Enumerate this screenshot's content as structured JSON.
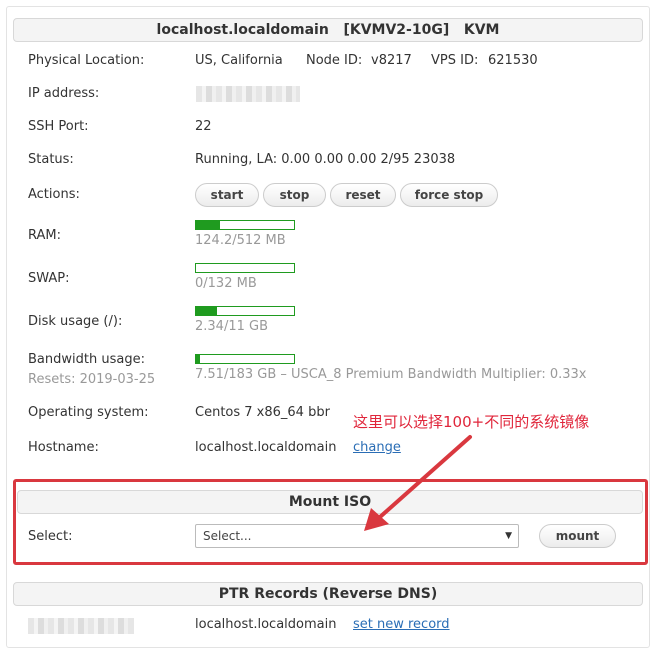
{
  "header": {
    "title": "localhost.localdomain   [KVMV2-10G]   KVM"
  },
  "info": {
    "physical_location_label": "Physical Location:",
    "physical_location_value": "US, California",
    "node_id_label": "Node ID:",
    "node_id_value": "v8217",
    "vps_id_label": "VPS ID:",
    "vps_id_value": "621530",
    "ip_label": "IP address:",
    "ssh_port_label": "SSH Port:",
    "ssh_port_value": "22",
    "status_label": "Status:",
    "status_value": "Running, LA: 0.00 0.00 0.00 2/95 23038",
    "actions_label": "Actions:",
    "ram_label": "RAM:",
    "ram_value": "124.2/512 MB",
    "swap_label": "SWAP:",
    "swap_value": "0/132 MB",
    "disk_label": "Disk usage (/):",
    "disk_value": "2.34/11 GB",
    "bandwidth_label": "Bandwidth usage:",
    "bandwidth_resets": "Resets: 2019-03-25",
    "bandwidth_value": "7.51/183 GB – USCA_8 Premium Bandwidth Multiplier: 0.33x",
    "os_label": "Operating system:",
    "os_value": "Centos 7 x86_64 bbr",
    "hostname_label": "Hostname:",
    "hostname_value": "localhost.localdomain",
    "hostname_change": "change"
  },
  "usage": {
    "ram_fraction": 0.243,
    "swap_fraction": 0.0,
    "disk_fraction": 0.213,
    "bandwidth_fraction": 0.041
  },
  "actions": {
    "start": "start",
    "stop": "stop",
    "reset": "reset",
    "force_stop": "force stop"
  },
  "annotation": "这里可以选择100+不同的系统镜像",
  "mount_iso": {
    "title": "Mount ISO",
    "select_label": "Select:",
    "select_value": "Select...",
    "mount_button": "mount"
  },
  "ptr": {
    "title": "PTR Records (Reverse DNS)",
    "hostname": "localhost.localdomain",
    "set_new_record": "set new record"
  },
  "colors": {
    "accent_red": "#d9383f",
    "bar_green": "#1f9b1f",
    "link_blue": "#2a6db5"
  }
}
